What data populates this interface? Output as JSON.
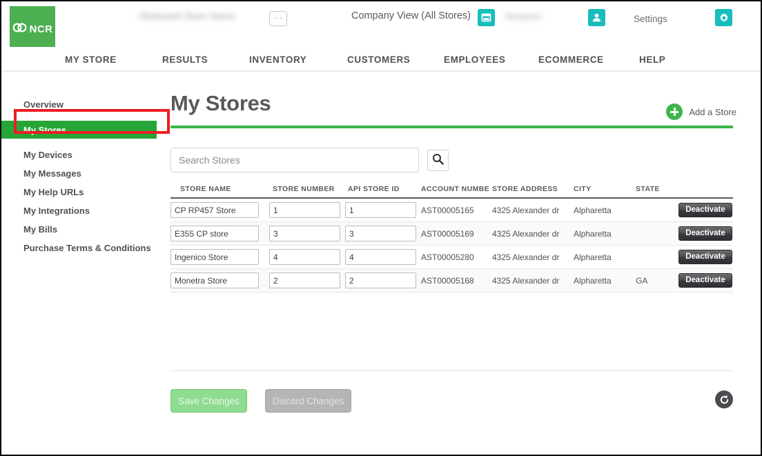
{
  "header": {
    "logo_text": "NCR",
    "logo_icon": "ncr-infinity-logo",
    "blurred_company": "Redacted Store Name",
    "blurred_user": "Redacted",
    "dots_button_label": "...",
    "company_view_label": "Company View (All Stores)",
    "settings_label": "Settings",
    "store_icon": "store-icon",
    "person_icon": "person-icon",
    "gear_icon": "gear-icon",
    "brand_green": "#4caf50",
    "accent_teal": "#17bebb"
  },
  "nav": {
    "items": [
      {
        "label": "MY STORE"
      },
      {
        "label": "RESULTS"
      },
      {
        "label": "INVENTORY"
      },
      {
        "label": "CUSTOMERS"
      },
      {
        "label": "EMPLOYEES"
      },
      {
        "label": "ECOMMERCE"
      },
      {
        "label": "HELP"
      }
    ]
  },
  "sidebar": {
    "items": [
      {
        "label": "Overview",
        "active": false
      },
      {
        "label": "My Stores",
        "active": true
      },
      {
        "label": "My Devices",
        "active": false
      },
      {
        "label": "My Messages",
        "active": false
      },
      {
        "label": "My Help URLs",
        "active": false
      },
      {
        "label": "My Integrations",
        "active": false
      },
      {
        "label": "My Bills",
        "active": false
      },
      {
        "label": "Purchase Terms & Conditions",
        "active": false
      }
    ],
    "active_color": "#27a536",
    "highlight_box_color": "#ed1c24"
  },
  "main": {
    "page_title": "My Stores",
    "title_rule_color": "#3cb54a",
    "add_store_label": "Add a Store",
    "add_store_icon": "plus-circle-icon",
    "search": {
      "placeholder": "Search Stores",
      "value": "",
      "button_icon": "search-icon"
    },
    "table": {
      "columns": [
        "STORE NAME",
        "STORE NUMBER",
        "API STORE ID",
        "ACCOUNT NUMBE",
        "STORE ADDRESS",
        "CITY",
        "STATE",
        ""
      ],
      "rows": [
        {
          "store_name": "CP RP457 Store",
          "store_number": "1",
          "api_store_id": "1",
          "account_number": "AST00005165",
          "store_address": "4325 Alexander dr",
          "city": "Alpharetta",
          "state": "",
          "action_label": "Deactivate"
        },
        {
          "store_name": "E355 CP store",
          "store_number": "3",
          "api_store_id": "3",
          "account_number": "AST00005169",
          "store_address": "4325 Alexander dr",
          "city": "Alpharetta",
          "state": "",
          "action_label": "Deactivate"
        },
        {
          "store_name": "Ingenico Store",
          "store_number": "4",
          "api_store_id": "4",
          "account_number": "AST00005280",
          "store_address": "4325 Alexander dr",
          "city": "Alpharetta",
          "state": "",
          "action_label": "Deactivate"
        },
        {
          "store_name": "Monetra Store",
          "store_number": "2",
          "api_store_id": "2",
          "account_number": "AST00005168",
          "store_address": "4325 Alexander dr",
          "city": "Alpharetta",
          "state": "GA",
          "action_label": "Deactivate"
        }
      ]
    },
    "actions": {
      "save_label": "Save Changes",
      "discard_label": "Discard Changes",
      "refresh_icon": "refresh-icon"
    }
  }
}
